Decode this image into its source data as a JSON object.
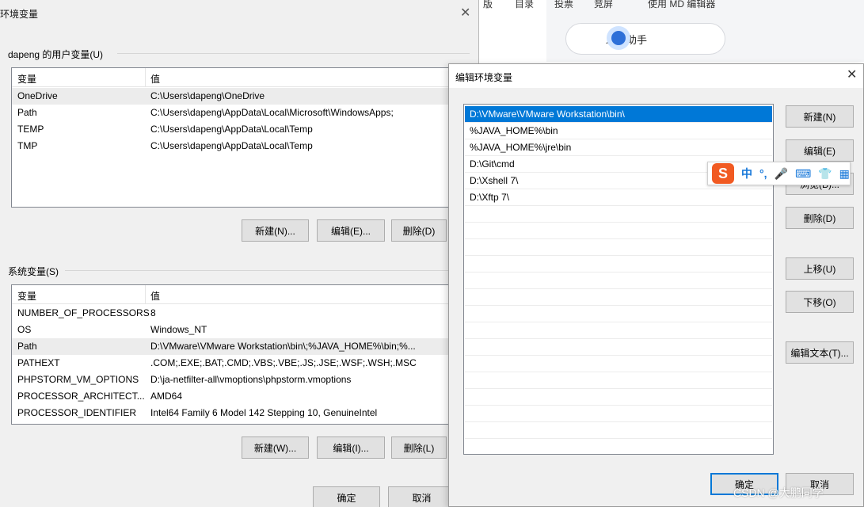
{
  "background": {
    "menu": [
      "版",
      "目录",
      "投票",
      "竞屏",
      "使用 MD 编辑器"
    ],
    "assistant_button": "发文助手"
  },
  "env_dialog": {
    "title": "环境变量",
    "user_group_label": "dapeng 的用户变量(U)",
    "user_table": {
      "headers": [
        "变量",
        "值"
      ],
      "rows": [
        [
          "OneDrive",
          "C:\\Users\\dapeng\\OneDrive"
        ],
        [
          "Path",
          "C:\\Users\\dapeng\\AppData\\Local\\Microsoft\\WindowsApps;"
        ],
        [
          "TEMP",
          "C:\\Users\\dapeng\\AppData\\Local\\Temp"
        ],
        [
          "TMP",
          "C:\\Users\\dapeng\\AppData\\Local\\Temp"
        ]
      ]
    },
    "user_buttons": {
      "new": "新建(N)...",
      "edit": "编辑(E)...",
      "delete": "删除(D)"
    },
    "system_group_label": "系统变量(S)",
    "system_table": {
      "headers": [
        "变量",
        "值"
      ],
      "rows": [
        [
          "NUMBER_OF_PROCESSORS",
          "8"
        ],
        [
          "OS",
          "Windows_NT"
        ],
        [
          "Path",
          "D:\\VMware\\VMware Workstation\\bin\\;%JAVA_HOME%\\bin;%..."
        ],
        [
          "PATHEXT",
          ".COM;.EXE;.BAT;.CMD;.VBS;.VBE;.JS;.JSE;.WSF;.WSH;.MSC"
        ],
        [
          "PHPSTORM_VM_OPTIONS",
          "D:\\ja-netfilter-all\\vmoptions\\phpstorm.vmoptions"
        ],
        [
          "PROCESSOR_ARCHITECT...",
          "AMD64"
        ],
        [
          "PROCESSOR_IDENTIFIER",
          "Intel64 Family 6 Model 142 Stepping 10, GenuineIntel"
        ]
      ]
    },
    "system_buttons": {
      "new": "新建(W)...",
      "edit": "编辑(I)...",
      "delete": "删除(L)"
    },
    "ok": "确定",
    "cancel": "取消"
  },
  "edit_dialog": {
    "title": "编辑环境变量",
    "paths": [
      "D:\\VMware\\VMware Workstation\\bin\\",
      "%JAVA_HOME%\\bin",
      "%JAVA_HOME%\\jre\\bin",
      "D:\\Git\\cmd",
      "D:\\Xshell 7\\",
      "D:\\Xftp 7\\"
    ],
    "buttons": {
      "new": "新建(N)",
      "edit": "编辑(E)",
      "browse": "浏览(B)...",
      "delete": "删除(D)",
      "move_up": "上移(U)",
      "move_down": "下移(O)",
      "edit_text": "编辑文本(T)..."
    },
    "ok": "确定",
    "cancel": "取消"
  },
  "ime": {
    "logo": "S",
    "items": [
      "中",
      "°,",
      "🎤",
      "⌨",
      "👕",
      "▦"
    ]
  },
  "watermark": "CSDN @大鹏同学"
}
